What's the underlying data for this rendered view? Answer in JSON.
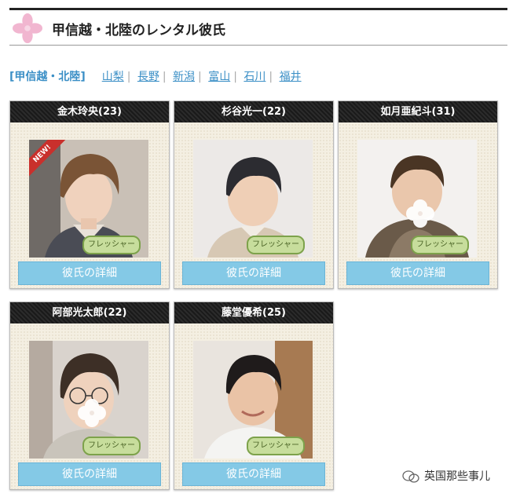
{
  "page": {
    "title": "甲信越・北陸のレンタル彼氏"
  },
  "nav": {
    "current": "[甲信越・北陸]",
    "links": [
      "山梨",
      "長野",
      "新潟",
      "富山",
      "石川",
      "福井"
    ]
  },
  "cards": [
    {
      "name": "金木玲央(23)",
      "badge": "フレッシャー",
      "button": "彼氏の詳細",
      "new": "NEW!"
    },
    {
      "name": "杉谷光一(22)",
      "badge": "フレッシャー",
      "button": "彼氏の詳細"
    },
    {
      "name": "如月亜紀斗(31)",
      "badge": "フレッシャー",
      "button": "彼氏の詳細"
    },
    {
      "name": "阿部光太郎(22)",
      "badge": "フレッシャー",
      "button": "彼氏の詳細"
    },
    {
      "name": "藤堂優希(25)",
      "badge": "フレッシャー",
      "button": "彼氏の詳細"
    }
  ],
  "watermark": {
    "text": "英国那些事儿",
    "icon": "wechat-icon"
  },
  "colors": {
    "accent_link": "#3b8fc6",
    "button": "#84c9e6",
    "card_header": "#222222",
    "badge": "#c7dd9c"
  }
}
